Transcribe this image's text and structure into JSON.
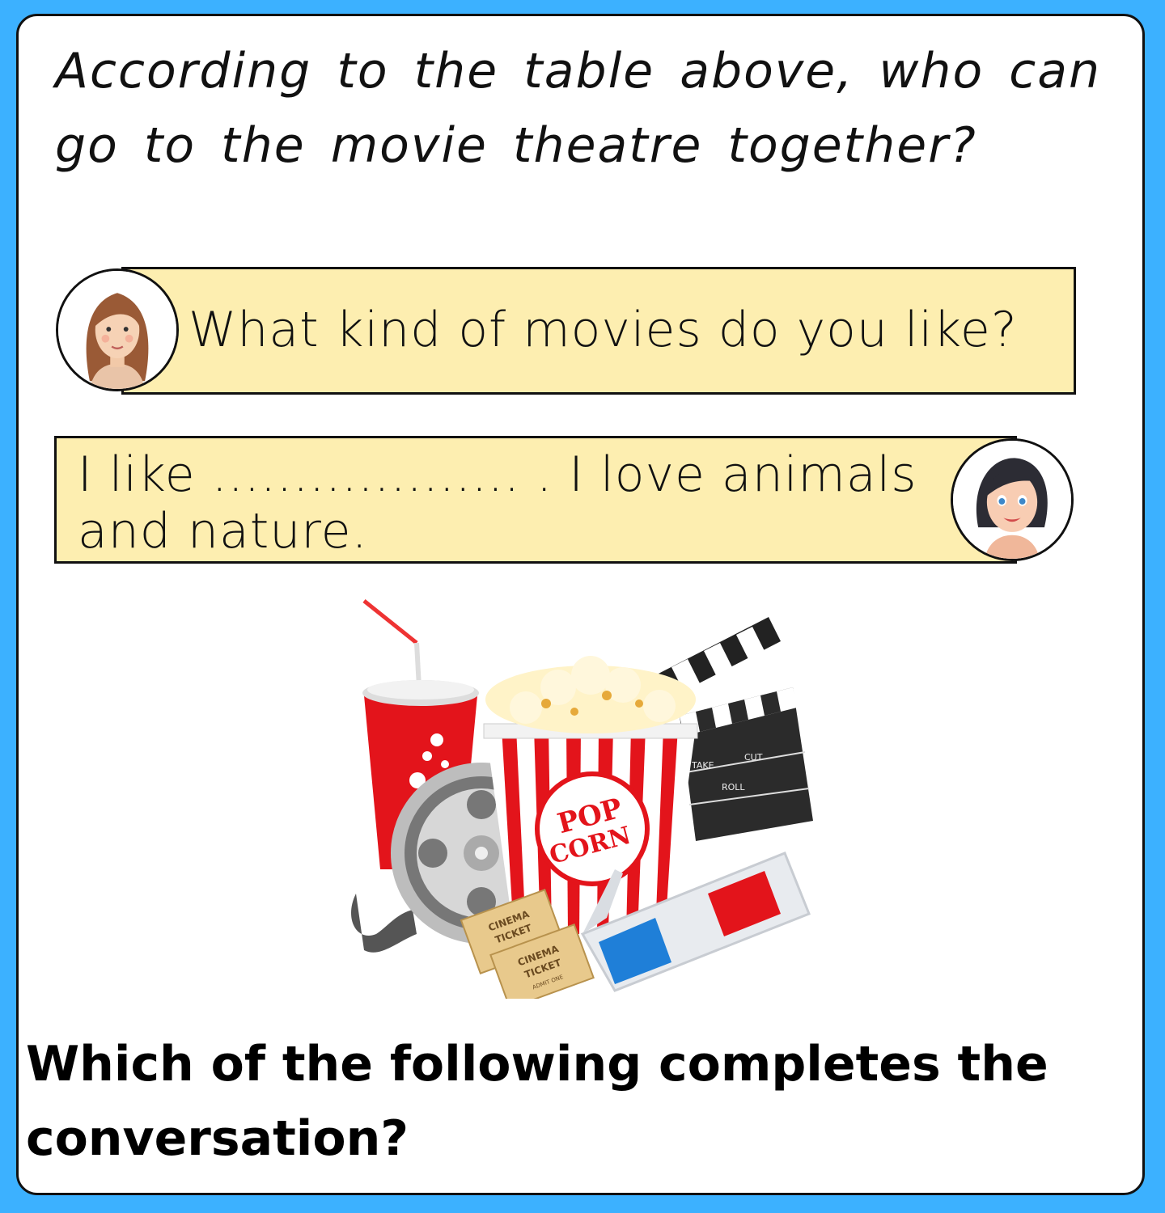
{
  "intro_question": "According to the table above, who can go to the movie theatre together?",
  "conversation": {
    "line1": "What kind of movies do you like?",
    "line2": "I like ................... . I love animals and nature."
  },
  "illustration": {
    "popcorn_label_1": "POP",
    "popcorn_label_2": "CORN",
    "clapper_label_take": "TAKE",
    "clapper_label_cut": "CUT",
    "clapper_label_roll": "ROLL",
    "ticket_line_1": "CINEMA",
    "ticket_line_2": "TICKET",
    "ticket_line_3": "ADMIT ONE"
  },
  "main_question": "Which of the following completes the conversation?"
}
